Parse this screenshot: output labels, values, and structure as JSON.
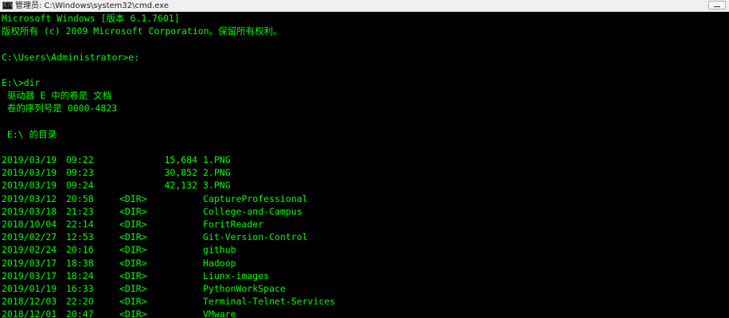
{
  "window": {
    "title": "管理员: C:\\Windows\\system32\\cmd.exe"
  },
  "console": {
    "header_lines": [
      "Microsoft Windows [版本 6.1.7601]",
      "版权所有 (c) 2009 Microsoft Corporation。保留所有权利。",
      "",
      "C:\\Users\\Administrator>e:",
      "",
      "E:\\>dir",
      " 驱动器 E 中的卷是 文档",
      " 卷的序列号是 0000-4823",
      "",
      " E:\\ 的目录",
      ""
    ],
    "entries": [
      {
        "date": "2019/03/19",
        "time": "09:22",
        "dir": "",
        "size": "15,684",
        "name": "1.PNG"
      },
      {
        "date": "2019/03/19",
        "time": "09:23",
        "dir": "",
        "size": "30,852",
        "name": "2.PNG"
      },
      {
        "date": "2019/03/19",
        "time": "09:24",
        "dir": "",
        "size": "42,132",
        "name": "3.PNG"
      },
      {
        "date": "2019/03/12",
        "time": "20:58",
        "dir": "<DIR>",
        "size": "",
        "name": "CaptureProfessional"
      },
      {
        "date": "2019/03/18",
        "time": "21:23",
        "dir": "<DIR>",
        "size": "",
        "name": "College-and-Campus"
      },
      {
        "date": "2018/10/04",
        "time": "22:14",
        "dir": "<DIR>",
        "size": "",
        "name": "ForitReader"
      },
      {
        "date": "2019/02/27",
        "time": "12:53",
        "dir": "<DIR>",
        "size": "",
        "name": "Git-Version-Control"
      },
      {
        "date": "2019/02/24",
        "time": "20:16",
        "dir": "<DIR>",
        "size": "",
        "name": "github"
      },
      {
        "date": "2019/03/17",
        "time": "18:38",
        "dir": "<DIR>",
        "size": "",
        "name": "Hadoop"
      },
      {
        "date": "2019/03/17",
        "time": "18:24",
        "dir": "<DIR>",
        "size": "",
        "name": "Liunx-images"
      },
      {
        "date": "2019/01/19",
        "time": "16:33",
        "dir": "<DIR>",
        "size": "",
        "name": "PythonWorkSpace"
      },
      {
        "date": "2018/12/03",
        "time": "22:20",
        "dir": "<DIR>",
        "size": "",
        "name": "Terminal-Telnet-Services"
      },
      {
        "date": "2018/12/01",
        "time": "20:47",
        "dir": "<DIR>",
        "size": "",
        "name": "VMware"
      }
    ]
  }
}
